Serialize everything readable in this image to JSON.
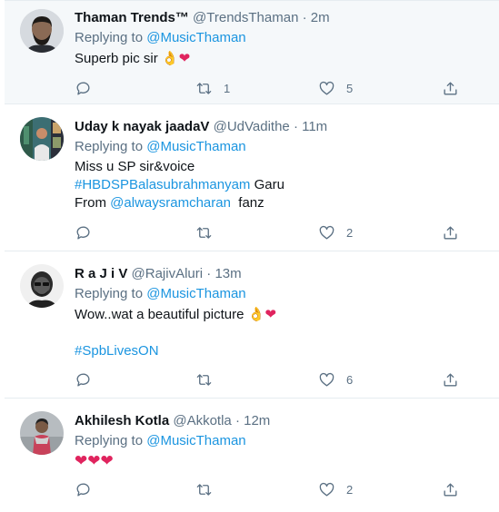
{
  "tweets": [
    {
      "name": "Thaman Trends™",
      "handle": "@TrendsThaman",
      "dot": "·",
      "time": "2m",
      "replying_prefix": "Replying to",
      "replying_to": "@MusicThaman",
      "lines": [
        {
          "parts": [
            {
              "text": "Superb pic sir ",
              "kind": "text"
            },
            {
              "text": "👌",
              "kind": "ok"
            },
            {
              "text": "❤",
              "kind": "heart"
            }
          ]
        }
      ],
      "retweets": "1",
      "likes": "5",
      "replies": ""
    },
    {
      "name": "Uday k nayak jaadaV",
      "handle": "@UdVadithe",
      "dot": "·",
      "time": "11m",
      "replying_prefix": "Replying to",
      "replying_to": "@MusicThaman",
      "lines": [
        {
          "parts": [
            {
              "text": "Miss u SP sir&voice",
              "kind": "text"
            }
          ]
        },
        {
          "parts": [
            {
              "text": "#HBDSPBalasubrahmanyam",
              "kind": "link"
            },
            {
              "text": " Garu",
              "kind": "text"
            }
          ]
        },
        {
          "parts": [
            {
              "text": "From ",
              "kind": "text"
            },
            {
              "text": "@alwaysramcharan",
              "kind": "link"
            },
            {
              "text": "  fanz",
              "kind": "text"
            }
          ]
        }
      ],
      "retweets": "",
      "likes": "2",
      "replies": ""
    },
    {
      "name": "R a J i V",
      "handle": "@RajivAluri",
      "dot": "·",
      "time": "13m",
      "replying_prefix": "Replying to",
      "replying_to": "@MusicThaman",
      "lines": [
        {
          "parts": [
            {
              "text": "Wow..wat a beautiful picture ",
              "kind": "text"
            },
            {
              "text": "👌",
              "kind": "ok"
            },
            {
              "text": "❤",
              "kind": "heart"
            }
          ]
        },
        {
          "parts": [
            {
              "text": "",
              "kind": "text"
            }
          ]
        },
        {
          "parts": [
            {
              "text": "#SpbLivesON",
              "kind": "link"
            }
          ]
        }
      ],
      "retweets": "",
      "likes": "6",
      "replies": ""
    },
    {
      "name": "Akhilesh Kotla",
      "handle": "@Akkotla",
      "dot": "·",
      "time": "12m",
      "replying_prefix": "Replying to",
      "replying_to": "@MusicThaman",
      "lines": [
        {
          "parts": [
            {
              "text": "❤❤❤",
              "kind": "heart"
            }
          ]
        }
      ],
      "retweets": "",
      "likes": "2",
      "replies": ""
    }
  ]
}
